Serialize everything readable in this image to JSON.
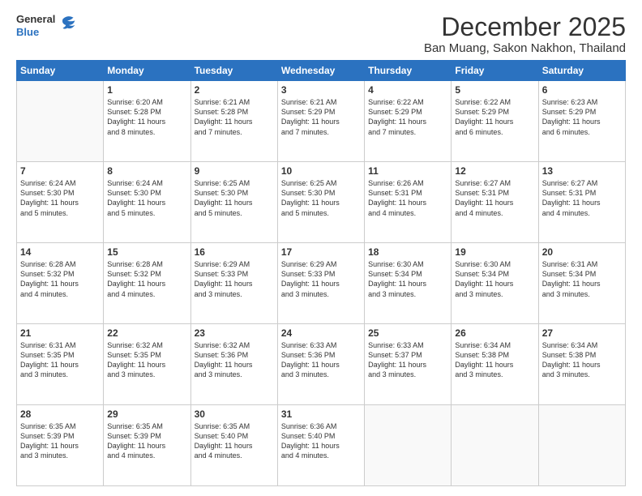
{
  "header": {
    "logo_general": "General",
    "logo_blue": "Blue",
    "title": "December 2025",
    "subtitle": "Ban Muang, Sakon Nakhon, Thailand"
  },
  "calendar": {
    "days_of_week": [
      "Sunday",
      "Monday",
      "Tuesday",
      "Wednesday",
      "Thursday",
      "Friday",
      "Saturday"
    ],
    "weeks": [
      [
        {
          "day": "",
          "info": ""
        },
        {
          "day": "1",
          "info": "Sunrise: 6:20 AM\nSunset: 5:28 PM\nDaylight: 11 hours\nand 8 minutes."
        },
        {
          "day": "2",
          "info": "Sunrise: 6:21 AM\nSunset: 5:28 PM\nDaylight: 11 hours\nand 7 minutes."
        },
        {
          "day": "3",
          "info": "Sunrise: 6:21 AM\nSunset: 5:29 PM\nDaylight: 11 hours\nand 7 minutes."
        },
        {
          "day": "4",
          "info": "Sunrise: 6:22 AM\nSunset: 5:29 PM\nDaylight: 11 hours\nand 7 minutes."
        },
        {
          "day": "5",
          "info": "Sunrise: 6:22 AM\nSunset: 5:29 PM\nDaylight: 11 hours\nand 6 minutes."
        },
        {
          "day": "6",
          "info": "Sunrise: 6:23 AM\nSunset: 5:29 PM\nDaylight: 11 hours\nand 6 minutes."
        }
      ],
      [
        {
          "day": "7",
          "info": "Sunrise: 6:24 AM\nSunset: 5:30 PM\nDaylight: 11 hours\nand 5 minutes."
        },
        {
          "day": "8",
          "info": "Sunrise: 6:24 AM\nSunset: 5:30 PM\nDaylight: 11 hours\nand 5 minutes."
        },
        {
          "day": "9",
          "info": "Sunrise: 6:25 AM\nSunset: 5:30 PM\nDaylight: 11 hours\nand 5 minutes."
        },
        {
          "day": "10",
          "info": "Sunrise: 6:25 AM\nSunset: 5:30 PM\nDaylight: 11 hours\nand 5 minutes."
        },
        {
          "day": "11",
          "info": "Sunrise: 6:26 AM\nSunset: 5:31 PM\nDaylight: 11 hours\nand 4 minutes."
        },
        {
          "day": "12",
          "info": "Sunrise: 6:27 AM\nSunset: 5:31 PM\nDaylight: 11 hours\nand 4 minutes."
        },
        {
          "day": "13",
          "info": "Sunrise: 6:27 AM\nSunset: 5:31 PM\nDaylight: 11 hours\nand 4 minutes."
        }
      ],
      [
        {
          "day": "14",
          "info": "Sunrise: 6:28 AM\nSunset: 5:32 PM\nDaylight: 11 hours\nand 4 minutes."
        },
        {
          "day": "15",
          "info": "Sunrise: 6:28 AM\nSunset: 5:32 PM\nDaylight: 11 hours\nand 4 minutes."
        },
        {
          "day": "16",
          "info": "Sunrise: 6:29 AM\nSunset: 5:33 PM\nDaylight: 11 hours\nand 3 minutes."
        },
        {
          "day": "17",
          "info": "Sunrise: 6:29 AM\nSunset: 5:33 PM\nDaylight: 11 hours\nand 3 minutes."
        },
        {
          "day": "18",
          "info": "Sunrise: 6:30 AM\nSunset: 5:34 PM\nDaylight: 11 hours\nand 3 minutes."
        },
        {
          "day": "19",
          "info": "Sunrise: 6:30 AM\nSunset: 5:34 PM\nDaylight: 11 hours\nand 3 minutes."
        },
        {
          "day": "20",
          "info": "Sunrise: 6:31 AM\nSunset: 5:34 PM\nDaylight: 11 hours\nand 3 minutes."
        }
      ],
      [
        {
          "day": "21",
          "info": "Sunrise: 6:31 AM\nSunset: 5:35 PM\nDaylight: 11 hours\nand 3 minutes."
        },
        {
          "day": "22",
          "info": "Sunrise: 6:32 AM\nSunset: 5:35 PM\nDaylight: 11 hours\nand 3 minutes."
        },
        {
          "day": "23",
          "info": "Sunrise: 6:32 AM\nSunset: 5:36 PM\nDaylight: 11 hours\nand 3 minutes."
        },
        {
          "day": "24",
          "info": "Sunrise: 6:33 AM\nSunset: 5:36 PM\nDaylight: 11 hours\nand 3 minutes."
        },
        {
          "day": "25",
          "info": "Sunrise: 6:33 AM\nSunset: 5:37 PM\nDaylight: 11 hours\nand 3 minutes."
        },
        {
          "day": "26",
          "info": "Sunrise: 6:34 AM\nSunset: 5:38 PM\nDaylight: 11 hours\nand 3 minutes."
        },
        {
          "day": "27",
          "info": "Sunrise: 6:34 AM\nSunset: 5:38 PM\nDaylight: 11 hours\nand 3 minutes."
        }
      ],
      [
        {
          "day": "28",
          "info": "Sunrise: 6:35 AM\nSunset: 5:39 PM\nDaylight: 11 hours\nand 3 minutes."
        },
        {
          "day": "29",
          "info": "Sunrise: 6:35 AM\nSunset: 5:39 PM\nDaylight: 11 hours\nand 4 minutes."
        },
        {
          "day": "30",
          "info": "Sunrise: 6:35 AM\nSunset: 5:40 PM\nDaylight: 11 hours\nand 4 minutes."
        },
        {
          "day": "31",
          "info": "Sunrise: 6:36 AM\nSunset: 5:40 PM\nDaylight: 11 hours\nand 4 minutes."
        },
        {
          "day": "",
          "info": ""
        },
        {
          "day": "",
          "info": ""
        },
        {
          "day": "",
          "info": ""
        }
      ]
    ]
  }
}
